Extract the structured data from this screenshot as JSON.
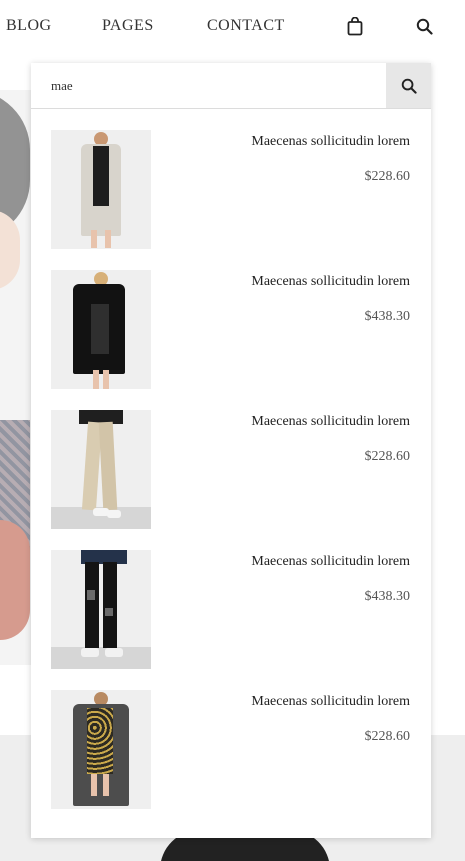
{
  "nav": {
    "items": [
      "BLOG",
      "PAGES",
      "CONTACT"
    ],
    "cart_icon": "shopping-bag-icon",
    "search_icon": "search-icon"
  },
  "search": {
    "value": "mae",
    "submit_icon": "search-icon"
  },
  "results": [
    {
      "name": "Maecenas sollicitudin lorem",
      "price": "$228.60",
      "image": "light-grey-coat"
    },
    {
      "name": "Maecenas sollicitudin lorem",
      "price": "$438.30",
      "image": "black-coat"
    },
    {
      "name": "Maecenas sollicitudin lorem",
      "price": "$228.60",
      "image": "beige-trousers"
    },
    {
      "name": "Maecenas sollicitudin lorem",
      "price": "$438.30",
      "image": "black-ripped-jeans"
    },
    {
      "name": "Maecenas sollicitudin lorem",
      "price": "$228.60",
      "image": "floral-dress-grey-coat"
    }
  ],
  "colors": {
    "text": "#333333",
    "search_button_bg": "#e7e7e7",
    "panel_bg": "#ffffff"
  }
}
